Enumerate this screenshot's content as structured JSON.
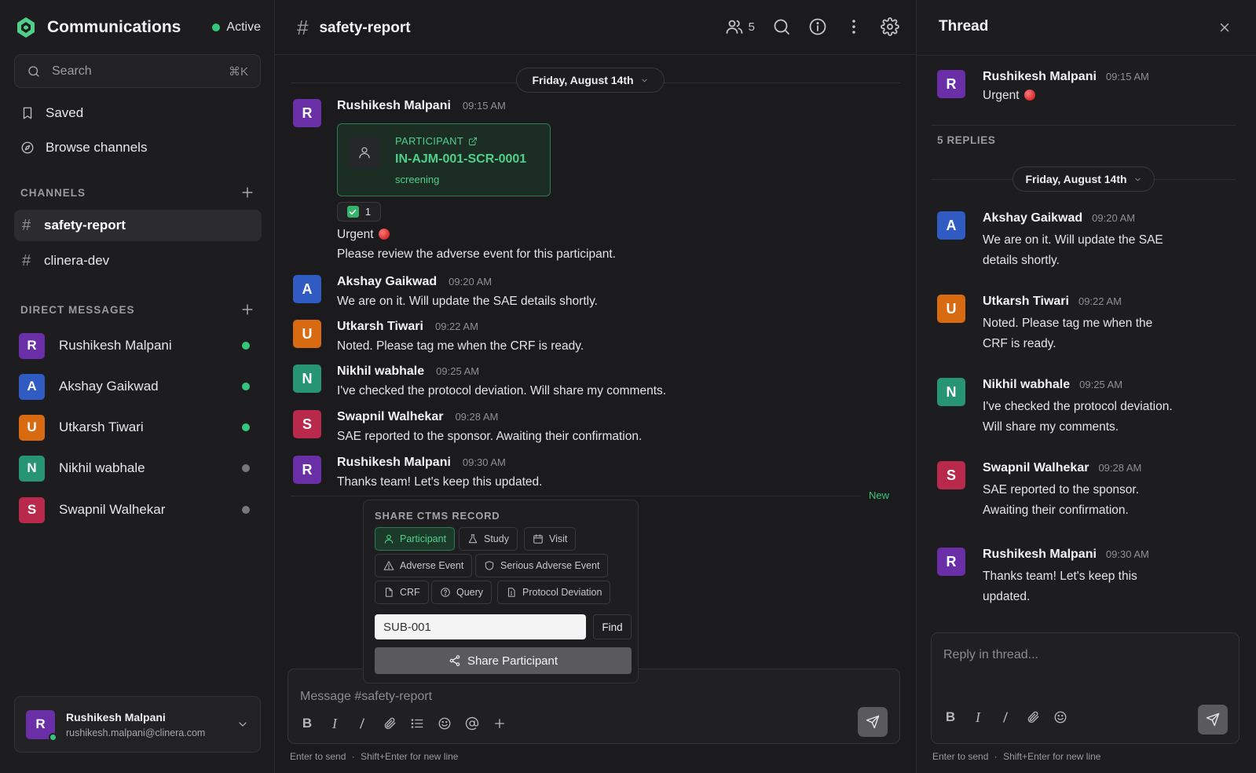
{
  "sidebar": {
    "app_title": "Communications",
    "status": "Active",
    "search_placeholder": "Search",
    "search_shortcut": "⌘K",
    "nav": [
      {
        "label": "Saved",
        "icon": "bookmark-icon"
      },
      {
        "label": "Browse channels",
        "icon": "compass-icon"
      }
    ],
    "channels_label": "CHANNELS",
    "channels": [
      {
        "name": "safety-report",
        "active": true
      },
      {
        "name": "clinera-dev",
        "active": false
      }
    ],
    "dm_label": "DIRECT MESSAGES",
    "direct_messages": [
      {
        "initial": "R",
        "name": "Rushikesh Malpani",
        "online": true,
        "color": "#6a2fa6"
      },
      {
        "initial": "A",
        "name": "Akshay Gaikwad",
        "online": true,
        "color": "#2f5bc2"
      },
      {
        "initial": "U",
        "name": "Utkarsh Tiwari",
        "online": true,
        "color": "#d86a12"
      },
      {
        "initial": "N",
        "name": "Nikhil wabhale",
        "online": false,
        "color": "#279474"
      },
      {
        "initial": "S",
        "name": "Swapnil Walhekar",
        "online": false,
        "color": "#b8294b"
      }
    ],
    "current_user": {
      "initial": "R",
      "name": "Rushikesh Malpani",
      "email": "rushikesh.malpani@clinera.com"
    }
  },
  "channel": {
    "hash": "#",
    "name": "safety-report",
    "member_count": "5",
    "date_divider": "Friday, August 14th",
    "messages": [
      {
        "initial": "R",
        "author": "Rushikesh Malpani",
        "time": "09:15 AM",
        "text": "Please review the adverse event for this participant."
      },
      {
        "initial": "A",
        "author": "Akshay Gaikwad",
        "time": "09:20 AM",
        "text": "We are on it. Will update the SAE details shortly."
      },
      {
        "initial": "U",
        "author": "Utkarsh Tiwari",
        "time": "09:22 AM",
        "text": "Noted. Please tag me when the CRF is ready."
      },
      {
        "initial": "N",
        "author": "Nikhil wabhale",
        "time": "09:25 AM",
        "text": "I've checked the protocol deviation. Will share my comments."
      },
      {
        "initial": "S",
        "author": "Swapnil Walhekar",
        "time": "09:28 AM",
        "text": "SAE reported to the sponsor. Awaiting their confirmation."
      },
      {
        "initial": "R",
        "author": "Rushikesh Malpani",
        "time": "09:30 AM",
        "text": "Thanks team! Let's keep this updated."
      }
    ],
    "record_card": {
      "type": "PARTICIPANT",
      "id": "IN-AJM-001-SCR-0001",
      "status": "screening"
    },
    "reaction_count": "1",
    "urgent_text": "Urgent",
    "new_label": "New"
  },
  "share_popover": {
    "title": "SHARE CTMS RECORD",
    "chips": [
      {
        "label": "Participant",
        "icon": "user-icon",
        "active": true
      },
      {
        "label": "Study",
        "icon": "flask-icon",
        "active": false
      },
      {
        "label": "Visit",
        "icon": "calendar-icon",
        "active": false
      },
      {
        "label": "Adverse Event",
        "icon": "warning-icon",
        "active": false
      },
      {
        "label": "Serious Adverse Event",
        "icon": "shield-icon",
        "active": false
      },
      {
        "label": "CRF",
        "icon": "document-icon",
        "active": false
      },
      {
        "label": "Query",
        "icon": "help-icon",
        "active": false
      },
      {
        "label": "Protocol Deviation",
        "icon": "file-alert-icon",
        "active": false
      }
    ],
    "input_value": "SUB-001",
    "find_label": "Find",
    "share_label": "Share Participant"
  },
  "composer": {
    "placeholder": "Message #safety-report",
    "hint_send": "Enter to send",
    "hint_sep": "·",
    "hint_newline": "Shift+Enter for new line"
  },
  "thread": {
    "title": "Thread",
    "parent": {
      "initial": "R",
      "author": "Rushikesh Malpani",
      "time": "09:15 AM",
      "text": "Urgent"
    },
    "replies_label": "5 REPLIES",
    "date_divider": "Friday, August 14th",
    "replies": [
      {
        "initial": "A",
        "author": "Akshay Gaikwad",
        "time": "09:20 AM",
        "line1": "We are on it. Will update the SAE",
        "line2": "details shortly."
      },
      {
        "initial": "U",
        "author": "Utkarsh Tiwari",
        "time": "09:22 AM",
        "line1": "Noted. Please tag me when the",
        "line2": "CRF is ready."
      },
      {
        "initial": "N",
        "author": "Nikhil wabhale",
        "time": "09:25 AM",
        "line1": "I've checked the protocol deviation.",
        "line2": "Will share my comments."
      },
      {
        "initial": "S",
        "author": "Swapnil Walhekar",
        "time": "09:28 AM",
        "line1": "SAE reported to the sponsor.",
        "line2": "Awaiting their confirmation."
      },
      {
        "initial": "R",
        "author": "Rushikesh Malpani",
        "time": "09:30 AM",
        "line1": "Thanks team! Let's keep this",
        "line2": "updated."
      }
    ],
    "reply_placeholder": "Reply in thread...",
    "hint_send": "Enter to send",
    "hint_sep": "·",
    "hint_newline": "Shift+Enter for new line"
  },
  "colors": {
    "accent": "#34c77b",
    "background": "#1b1b1d",
    "card_green": "#4fcf8a"
  }
}
